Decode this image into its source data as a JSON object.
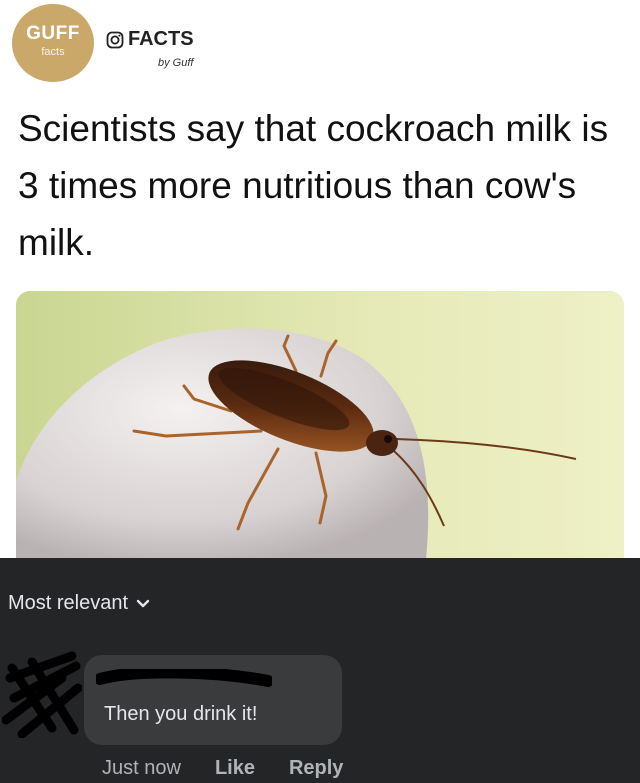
{
  "post": {
    "logo": {
      "main": "GUFF",
      "sub": "facts"
    },
    "brand": {
      "icon": "instagram-icon",
      "name": "FACTS"
    },
    "byline": "by Guff",
    "headline": "Scientists say that cockroach milk is 3 times more nutritious than cow's milk.",
    "photo": {
      "subject": "cockroach-photo"
    }
  },
  "comments": {
    "sort_label": "Most relevant",
    "comment": {
      "text": "Then you drink it!",
      "actions": {
        "time": "Just now",
        "like": "Like",
        "reply": "Reply"
      }
    }
  },
  "colors": {
    "logo": "#c9a86a",
    "dark_bg": "#242526",
    "bubble": "#3a3b3c",
    "text_light": "#e4e6eb",
    "text_muted": "#b0b3b8"
  }
}
